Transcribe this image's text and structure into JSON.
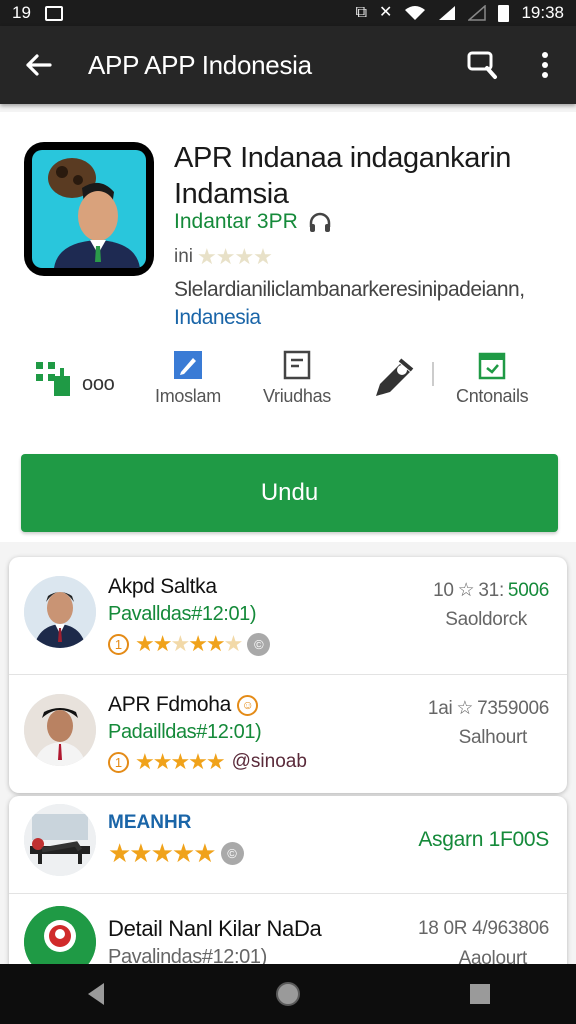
{
  "status": {
    "left_num": "19",
    "time": "19:38"
  },
  "appbar": {
    "title": "APP APP Indonesia"
  },
  "app": {
    "title": "APR Indanaa indagankarin Indamsia",
    "developer": "Indantar 3PR",
    "rating_prefix": "ini",
    "description": "Slelardianiliclambanarkeresinipadeiann,",
    "description_link": "Indanesia"
  },
  "actions": [
    {
      "label": "ooo",
      "icon": "apps-grid-icon"
    },
    {
      "label": "Imoslam",
      "icon": "edit-icon"
    },
    {
      "label": "Vriudhas",
      "icon": "document-icon"
    },
    {
      "label": "",
      "icon": "pen-icon"
    },
    {
      "label": "Cntonails",
      "icon": "calendar-icon"
    }
  ],
  "install_label": "Undu",
  "reviews_card1": [
    {
      "name": "Akpd Saltka",
      "sub": "Pavalldas#12:01)",
      "badge_num": "1",
      "stars_on": 4,
      "right_a": "10",
      "right_b": "31:",
      "right_c": "5006",
      "right_line2": "Saoldorck",
      "extra_tag": ""
    },
    {
      "name": "APR Fdmoha",
      "sub": "Padailldas#12:01)",
      "badge_num": "1",
      "stars_on": 5,
      "right_a": "1ai",
      "right_b": "7359006",
      "right_c": "",
      "right_line2": "Salhourt",
      "extra_tag": "@sinoab"
    }
  ],
  "reviews_card2": [
    {
      "label": "MEANHR",
      "stars_on": 5,
      "right": "Asgarn 1F00S"
    },
    {
      "name": "Detail Nanl Kilar NaDa",
      "sub": "Pavalindas#12:01)",
      "right_a": "18 0R 4/963806",
      "right_line2": "Aaolourt"
    }
  ],
  "colors": {
    "accent_green": "#1f9a45",
    "dark_bar": "#262626",
    "link_blue": "#1a65a8",
    "star_orange": "#f0a21a"
  }
}
